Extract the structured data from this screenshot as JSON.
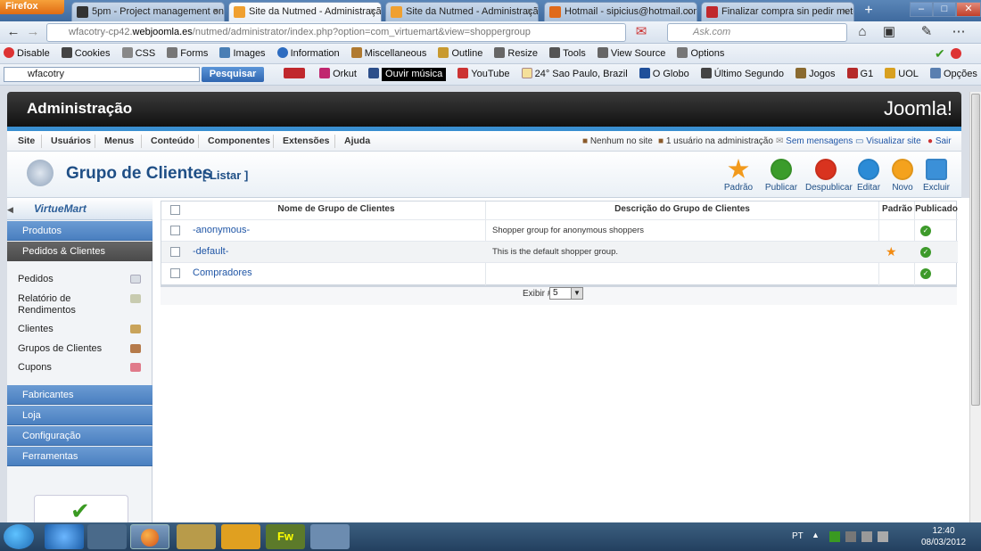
{
  "browser": {
    "menu_button": "Firefox",
    "tabs": [
      {
        "title": "5pm - Project management on ...",
        "active": false,
        "icon_color": "#333333"
      },
      {
        "title": "Site da Nutmed - Administração",
        "active": true,
        "icon_color": "#f0a030"
      },
      {
        "title": "Site da Nutmed - Administração",
        "active": false,
        "icon_color": "#f0a030"
      },
      {
        "title": "Hotmail - sipicius@hotmail.com",
        "active": false,
        "icon_color": "#e06a1a"
      },
      {
        "title": "Finalizar compra sin pedir meto...",
        "active": false,
        "icon_color": "#c0282d"
      }
    ],
    "new_tab": "+",
    "url_prefix": "wfacotry-cp42.",
    "url_domain": "webjoomla.es",
    "url_rest": "/nutmed/administrator/index.php?option=com_virtuemart&view=shoppergroup",
    "ask_placeholder": "Ask.com"
  },
  "webdev_toolbar": [
    "Disable",
    "Cookies",
    "CSS",
    "Forms",
    "Images",
    "Information",
    "Miscellaneous",
    "Outline",
    "Resize",
    "Tools",
    "View Source",
    "Options"
  ],
  "search_toolbar": {
    "query": "wfacotry",
    "search_button": "Pesquisar",
    "items": [
      "Orkut",
      "YouTube",
      "24° Sao Paulo, Brazil",
      "O Globo",
      "Último Segundo",
      "Jogos",
      "G1",
      "UOL",
      "Opções"
    ],
    "music": "Ouvir música"
  },
  "joomla": {
    "header_title": "Administração",
    "logo_text": "Joomla!",
    "menu": [
      "Site",
      "Usuários",
      "Menus",
      "Conteúdo",
      "Componentes",
      "Extensões",
      "Ajuda"
    ],
    "status": {
      "no_site": "Nenhum no site",
      "admins": "1 usuário na administração",
      "messages": "Sem mensagens",
      "view_site": "Visualizar site",
      "logout": "Sair"
    },
    "page_title": "Grupo de Clientes",
    "page_subtitle": "[ Listar ]",
    "toolbar": [
      {
        "label": "Padrão",
        "icon": "star-icon",
        "color": "#f29a1c"
      },
      {
        "label": "Publicar",
        "icon": "check-icon",
        "color": "#3b9c2b"
      },
      {
        "label": "Despublicar",
        "icon": "unpublish-icon",
        "color": "#d9331f"
      },
      {
        "label": "Editar",
        "icon": "pencil-icon",
        "color": "#2b8bd6"
      },
      {
        "label": "Novo",
        "icon": "plus-icon",
        "color": "#f4a21d"
      },
      {
        "label": "Excluir",
        "icon": "trash-icon",
        "color": "#3b90d8"
      }
    ]
  },
  "sidebar": {
    "logo": "VirtueMart",
    "sections": [
      "Produtos",
      "Pedidos & Clientes",
      "Fabricantes",
      "Loja",
      "Configuração",
      "Ferramentas"
    ],
    "items": [
      "Pedidos",
      "Relatório de Rendimentos",
      "Clientes",
      "Grupos de Clientes",
      "Cupons"
    ]
  },
  "table": {
    "headers": [
      "Nome de Grupo de Clientes",
      "Descrição do Grupo de Clientes",
      "Padrão",
      "Publicado"
    ],
    "rows": [
      {
        "name": "-anonymous-",
        "description": "Shopper group for anonymous shoppers",
        "default": false,
        "published": true
      },
      {
        "name": "-default-",
        "description": "This is the default shopper group.",
        "default": true,
        "published": true
      },
      {
        "name": "Compradores",
        "description": "",
        "default": false,
        "published": true
      }
    ],
    "display_label": "Exibir #",
    "display_value": "5"
  },
  "taskbar": {
    "language": "PT",
    "time": "12:40",
    "date": "08/03/2012"
  }
}
